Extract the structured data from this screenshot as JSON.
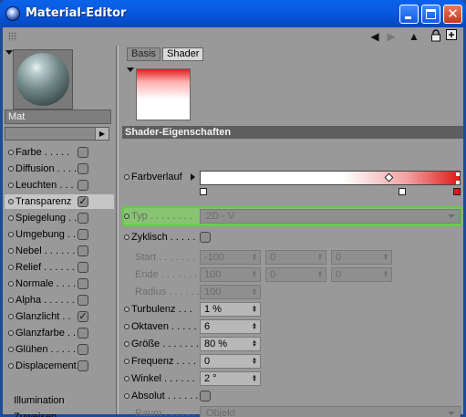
{
  "window": {
    "title": "Material-Editor"
  },
  "material": {
    "name": "Mat"
  },
  "channels": [
    {
      "label": "Farbe",
      "dots": " . . . . .",
      "checked": false
    },
    {
      "label": "Diffusion",
      "dots": " . . . .",
      "checked": false
    },
    {
      "label": "Leuchten",
      "dots": " . . . .",
      "checked": false
    },
    {
      "label": "Transparenz",
      "dots": "",
      "checked": true
    },
    {
      "label": "Spiegelung",
      "dots": " . .",
      "checked": false
    },
    {
      "label": "Umgebung",
      "dots": " . .",
      "checked": false
    },
    {
      "label": "Nebel",
      "dots": " . . . . . .",
      "checked": false
    },
    {
      "label": "Relief",
      "dots": " . . . . . .",
      "checked": false
    },
    {
      "label": "Normale",
      "dots": " . . . .",
      "checked": false
    },
    {
      "label": "Alpha",
      "dots": " . . . . . . .",
      "checked": false
    },
    {
      "label": "Glanzlicht",
      "dots": " . .",
      "checked": true
    },
    {
      "label": "Glanzfarbe",
      "dots": " . .",
      "checked": false
    },
    {
      "label": "Glühen",
      "dots": " . . . . . .",
      "checked": false
    },
    {
      "label": "Displacement",
      "dots": "",
      "checked": false
    }
  ],
  "extra_items": [
    "Illumination",
    "Zuweisen"
  ],
  "tabs": [
    "Basis",
    "Shader"
  ],
  "section_title": "Shader-Eigenschaften",
  "params": {
    "farbverlauf": "Farbverlauf",
    "typ": {
      "label": "Typ . . . . . . . .",
      "value": "2D - V"
    },
    "zyklisch": "Zyklisch . . . . .",
    "start": {
      "label": "Start . . . . . . .",
      "values": [
        "-100",
        "0",
        "0"
      ]
    },
    "ende": {
      "label": "Ende . . . . . . .",
      "values": [
        "100",
        "0",
        "0"
      ]
    },
    "radius": {
      "label": "Radius . . . . . .",
      "value": "100"
    },
    "turbulenz": {
      "label": "Turbulenz . . .",
      "value": "1 %"
    },
    "oktaven": {
      "label": "Oktaven . . . . .",
      "value": "6"
    },
    "groesse": {
      "label": "Größe . . . . . . .",
      "value": "80 %"
    },
    "frequenz": {
      "label": "Frequenz . . . .",
      "value": "0"
    },
    "winkel": {
      "label": "Winkel . . . . . .",
      "value": "2 °"
    },
    "absolut": "Absolut . . . . . .",
    "raum": {
      "label": "Raum . . . . . .",
      "value": "Objekt"
    }
  },
  "icons": {
    "title": "cinema4d-sphere-icon",
    "minimize": "minimize-icon",
    "maximize": "maximize-icon",
    "close": "close-icon",
    "back": "arrow-left-icon",
    "forward": "arrow-right-icon",
    "up": "arrow-up-icon",
    "lock": "lock-icon",
    "new": "new-window-icon"
  },
  "colors": {
    "titlebar": "#0a5ae0",
    "panel": "#999999",
    "section_header": "#5e5e5e",
    "highlight": "#5ed23a",
    "gradient_end": "#e01818"
  }
}
